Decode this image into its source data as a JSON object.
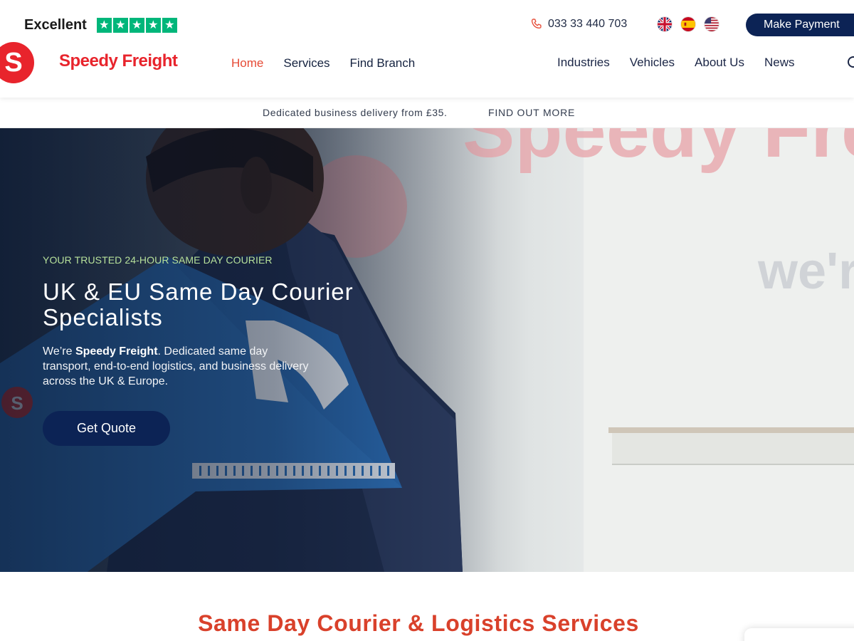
{
  "header": {
    "trustpilot": {
      "label": "Excellent",
      "stars": [
        "★",
        "★",
        "★",
        "★",
        "★"
      ],
      "color": "#00b67a"
    },
    "phone": "033 33 440 703",
    "flags": [
      "uk-flag",
      "spain-flag",
      "usa-flag"
    ],
    "make_payment": "Make Payment",
    "brand": {
      "mark": "S",
      "name": "Speedy Freight",
      "color": "#e8242c"
    },
    "nav_left": [
      {
        "label": "Home",
        "active": true
      },
      {
        "label": "Services",
        "active": false
      },
      {
        "label": "Find Branch",
        "active": false
      }
    ],
    "nav_right": [
      {
        "label": "Industries"
      },
      {
        "label": "Vehicles"
      },
      {
        "label": "About Us"
      },
      {
        "label": "News"
      }
    ]
  },
  "promo": {
    "text": "Dedicated business delivery from £35.",
    "link": "FIND OUT MORE"
  },
  "hero": {
    "eyebrow": "YOUR TRUSTED 24-HOUR SAME DAY COURIER",
    "title": "UK & EU Same Day Courier Specialists",
    "desc_prefix": "We’re ",
    "desc_brand": "Speedy Freight",
    "desc_suffix": ". Dedicated same day transport, end-to-end logistics, and business delivery across the UK & Europe.",
    "cta": "Get Quote",
    "van_text_top": "Speedy Frei",
    "van_text_sub": "we're"
  },
  "services": {
    "heading": "Same Day Courier & Logistics Services"
  },
  "colors": {
    "navy": "#0c2355",
    "accent_red": "#e64a35",
    "heading_red": "#d9412b",
    "eyebrow_green": "#b6e09a"
  }
}
